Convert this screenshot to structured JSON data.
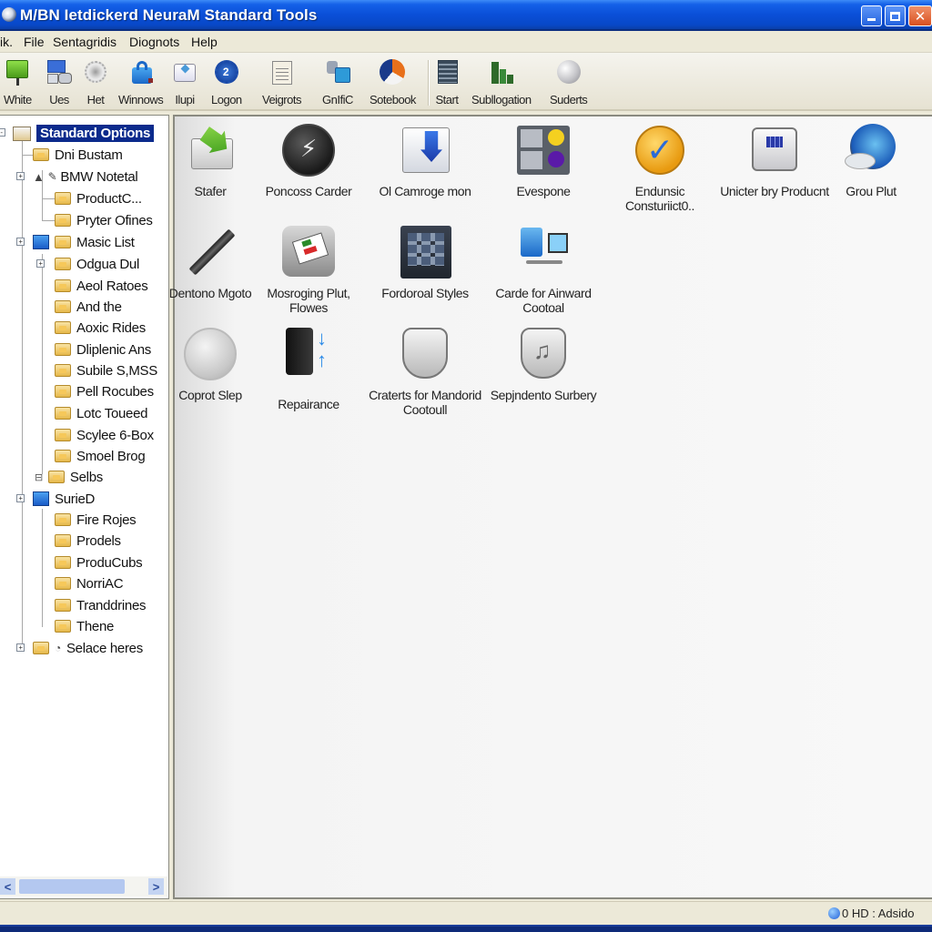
{
  "window": {
    "title": "M/BN Ietdickerd NeuraM Standard Tools",
    "controls": {
      "minimize": "_",
      "maximize": "□",
      "close": "✕"
    }
  },
  "menubar": {
    "items": [
      "ik.",
      "File",
      "Sentagridis",
      "Diognots",
      "Help"
    ]
  },
  "toolbar": {
    "buttons": [
      {
        "label": "White",
        "icon": "green-board-icon"
      },
      {
        "label": "Ues",
        "icon": "monitor-devices-icon"
      },
      {
        "label": "Het",
        "icon": "gear-icon"
      },
      {
        "label": "Winnows",
        "icon": "blue-bag-icon"
      },
      {
        "label": "Ilupi",
        "icon": "tray-icon"
      },
      {
        "label": "Logon",
        "icon": "blue-gear-icon"
      },
      {
        "label": "Veigrots",
        "icon": "clipboard-icon"
      },
      {
        "label": "GnIfiC",
        "icon": "network-icon"
      },
      {
        "label": "Sotebook",
        "icon": "swirl-logo-icon"
      },
      {
        "label": "Start",
        "icon": "building-icon"
      },
      {
        "label": "Subllogation",
        "icon": "green-chart-icon"
      },
      {
        "label": "Suderts",
        "icon": "silver-disc-icon"
      }
    ]
  },
  "tree": {
    "root": "Standard Options",
    "nodes": [
      {
        "label": "Dni Bustam",
        "level": 1
      },
      {
        "label": "BMW Notetal",
        "level": 1,
        "expandable": true
      },
      {
        "label": "ProductC...",
        "level": 2
      },
      {
        "label": "Pryter Ofines",
        "level": 2
      },
      {
        "label": "Masic List",
        "level": 1,
        "expandable": true
      },
      {
        "label": "Odgua Dul",
        "level": 2,
        "expandable": true
      },
      {
        "label": "Aeol Ratoes",
        "level": 2
      },
      {
        "label": "And the",
        "level": 2
      },
      {
        "label": "Aoxic Rides",
        "level": 2
      },
      {
        "label": "Dliplenic Ans",
        "level": 2
      },
      {
        "label": "Subile S,MSS",
        "level": 2
      },
      {
        "label": "Pell Rocubes",
        "level": 2
      },
      {
        "label": "Lotc Toueed",
        "level": 2
      },
      {
        "label": "Scylee 6-Box",
        "level": 2
      },
      {
        "label": "Smoel Brog",
        "level": 2
      },
      {
        "label": "Selbs",
        "level": 2
      },
      {
        "label": "SurieD",
        "level": 1,
        "expandable": true
      },
      {
        "label": "Fire Rojes",
        "level": 2
      },
      {
        "label": "Prodels",
        "level": 2
      },
      {
        "label": "ProduCubs",
        "level": 2
      },
      {
        "label": "NorriAC",
        "level": 2
      },
      {
        "label": "Tranddrines",
        "level": 2
      },
      {
        "label": "Thene",
        "level": 2
      },
      {
        "label": "Selace heres",
        "level": 1,
        "expandable": true
      }
    ]
  },
  "content": {
    "items": [
      {
        "label": "Stafer",
        "icon": "green-arrow-icon"
      },
      {
        "label": "Poncoss Carder",
        "icon": "dark-disc-icon"
      },
      {
        "label": "Ol Camroge mon",
        "icon": "blue-arrow-box-icon"
      },
      {
        "label": "Evespone",
        "icon": "color-grid-icon"
      },
      {
        "label": "Endunsic Consturiict0..",
        "icon": "orange-check-icon"
      },
      {
        "label": "Unicter bry Producnt",
        "icon": "device-panel-icon"
      },
      {
        "label": "Grou Plut",
        "icon": "globe-icon"
      },
      {
        "label": "Dentono Mgoto",
        "icon": "pen-icon"
      },
      {
        "label": "Mosroging Plut, Flowes",
        "icon": "document-scan-icon"
      },
      {
        "label": "Fordoroal Styles",
        "icon": "keypad-icon"
      },
      {
        "label": "Carde for Ainward Cootoal",
        "icon": "network-computer-icon"
      },
      {
        "label": "Coprot Slep",
        "icon": "silver-medal-icon"
      },
      {
        "label": "Repairance",
        "icon": "phone-sync-icon"
      },
      {
        "label": "Craterts for Mandorid Cootoull",
        "icon": "shield-icon"
      },
      {
        "label": "Sepjndento Surbery",
        "icon": "music-shield-icon"
      }
    ]
  },
  "statusbar": {
    "text": "0 HD : Adsido"
  }
}
